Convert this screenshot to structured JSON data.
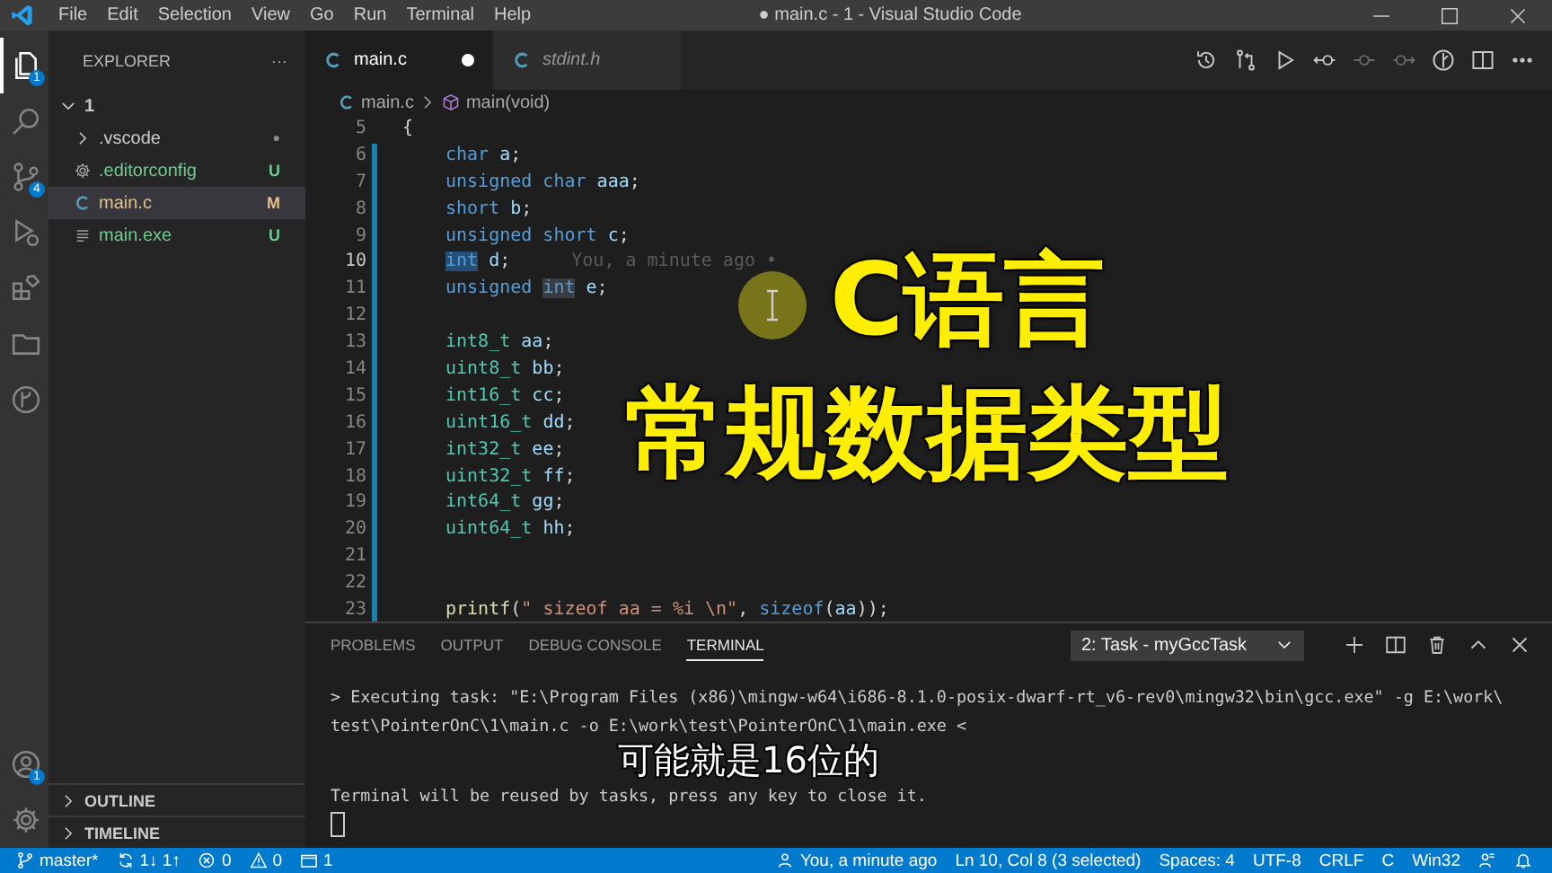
{
  "window": {
    "title": "● main.c - 1 - Visual Studio Code"
  },
  "menu": [
    "File",
    "Edit",
    "Selection",
    "View",
    "Go",
    "Run",
    "Terminal",
    "Help"
  ],
  "activity_bar": [
    {
      "kind": "explorer",
      "selected": true,
      "badge": "1"
    },
    {
      "kind": "search",
      "selected": false
    },
    {
      "kind": "source-control",
      "selected": false,
      "badge": "4"
    },
    {
      "kind": "run",
      "selected": false
    },
    {
      "kind": "extensions",
      "selected": false
    },
    {
      "kind": "folders",
      "selected": false
    },
    {
      "kind": "git-graph",
      "selected": false
    }
  ],
  "activity_bar_bottom": [
    {
      "kind": "account",
      "badge": "1"
    },
    {
      "kind": "settings"
    }
  ],
  "sidebar": {
    "title": "EXPLORER",
    "more": "···",
    "tree": [
      {
        "label": "1",
        "expanded": true,
        "children": [
          {
            "label": ".vscode",
            "kind": "folder",
            "expanded": false,
            "selected": false,
            "status": "●"
          },
          {
            "label": ".editorconfig",
            "kind": "config",
            "selected": false,
            "status": "U"
          },
          {
            "label": "main.c",
            "kind": "c",
            "selected": true,
            "status": "M"
          },
          {
            "label": "main.exe",
            "kind": "binary",
            "selected": false,
            "status": "U"
          }
        ]
      }
    ],
    "sections": [
      {
        "label": "OUTLINE",
        "expanded": false
      },
      {
        "label": "TIMELINE",
        "expanded": false
      }
    ]
  },
  "tabs": [
    {
      "label": "main.c",
      "selected": true,
      "dirty": true,
      "preview": false
    },
    {
      "label": "stdint.h",
      "selected": false,
      "dirty": false,
      "preview": true
    }
  ],
  "editor_actions": [
    {
      "kind": "history",
      "disabled": false
    },
    {
      "kind": "compare",
      "disabled": false
    },
    {
      "kind": "run",
      "disabled": false
    },
    {
      "kind": "commit-previous",
      "disabled": false
    },
    {
      "kind": "commit",
      "disabled": true
    },
    {
      "kind": "commit-next",
      "disabled": true
    },
    {
      "kind": "blame",
      "disabled": false
    },
    {
      "kind": "split",
      "disabled": false
    },
    {
      "kind": "more",
      "disabled": false
    }
  ],
  "breadcrumb": [
    {
      "label": "main.c",
      "kind": "file"
    },
    {
      "label": "main(void)",
      "kind": "function"
    }
  ],
  "code": [
    {
      "number": "5",
      "changed": false,
      "current": false,
      "indent": false,
      "tokens": [
        {
          "text": "{",
          "kind": "punct"
        }
      ]
    },
    {
      "number": "6",
      "changed": true,
      "current": false,
      "indent": true,
      "tokens": [
        {
          "text": "char",
          "kind": "keyword"
        },
        {
          "text": " a",
          "kind": "variable"
        },
        {
          "text": ";",
          "kind": "punct"
        }
      ]
    },
    {
      "number": "7",
      "changed": true,
      "current": false,
      "indent": true,
      "tokens": [
        {
          "text": "unsigned char",
          "kind": "keyword"
        },
        {
          "text": " aaa",
          "kind": "variable"
        },
        {
          "text": ";",
          "kind": "punct"
        }
      ]
    },
    {
      "number": "8",
      "changed": true,
      "current": false,
      "indent": true,
      "tokens": [
        {
          "text": "short",
          "kind": "keyword"
        },
        {
          "text": " b",
          "kind": "variable"
        },
        {
          "text": ";",
          "kind": "punct"
        }
      ]
    },
    {
      "number": "9",
      "changed": true,
      "current": false,
      "indent": true,
      "tokens": [
        {
          "text": "unsigned short",
          "kind": "keyword"
        },
        {
          "text": " c",
          "kind": "variable"
        },
        {
          "text": ";",
          "kind": "punct"
        }
      ]
    },
    {
      "number": "10",
      "changed": true,
      "current": true,
      "indent": true,
      "blame": "You, a minute ago •",
      "tokens": [
        {
          "text": "int",
          "kind": "keyword-selected"
        },
        {
          "text": " d",
          "kind": "variable"
        },
        {
          "text": ";",
          "kind": "punct"
        }
      ]
    },
    {
      "number": "11",
      "changed": true,
      "current": false,
      "indent": true,
      "tokens": [
        {
          "text": "unsigned ",
          "kind": "keyword"
        },
        {
          "text": "int",
          "kind": "keyword-match"
        },
        {
          "text": " e",
          "kind": "variable"
        },
        {
          "text": ";",
          "kind": "punct"
        }
      ]
    },
    {
      "number": "12",
      "changed": true,
      "current": false
    },
    {
      "number": "13",
      "changed": true,
      "current": false,
      "indent": true,
      "tokens": [
        {
          "text": "int8_t",
          "kind": "type"
        },
        {
          "text": " aa",
          "kind": "variable"
        },
        {
          "text": ";",
          "kind": "punct"
        }
      ]
    },
    {
      "number": "14",
      "changed": true,
      "current": false,
      "indent": true,
      "tokens": [
        {
          "text": "uint8_t",
          "kind": "type"
        },
        {
          "text": " bb",
          "kind": "variable"
        },
        {
          "text": ";",
          "kind": "punct"
        }
      ]
    },
    {
      "number": "15",
      "changed": true,
      "current": false,
      "indent": true,
      "tokens": [
        {
          "text": "int16_t",
          "kind": "type"
        },
        {
          "text": " cc",
          "kind": "variable"
        },
        {
          "text": ";",
          "kind": "punct"
        }
      ]
    },
    {
      "number": "16",
      "changed": true,
      "current": false,
      "indent": true,
      "tokens": [
        {
          "text": "uint16_t",
          "kind": "type"
        },
        {
          "text": " dd",
          "kind": "variable"
        },
        {
          "text": ";",
          "kind": "punct"
        }
      ]
    },
    {
      "number": "17",
      "changed": true,
      "current": false,
      "indent": true,
      "tokens": [
        {
          "text": "int32_t",
          "kind": "type"
        },
        {
          "text": " ee",
          "kind": "variable"
        },
        {
          "text": ";",
          "kind": "punct"
        }
      ]
    },
    {
      "number": "18",
      "changed": true,
      "current": false,
      "indent": true,
      "tokens": [
        {
          "text": "uint32_t",
          "kind": "type"
        },
        {
          "text": " ff",
          "kind": "variable"
        },
        {
          "text": ";",
          "kind": "punct"
        }
      ]
    },
    {
      "number": "19",
      "changed": true,
      "current": false,
      "indent": true,
      "tokens": [
        {
          "text": "int64_t",
          "kind": "type"
        },
        {
          "text": " gg",
          "kind": "variable"
        },
        {
          "text": ";",
          "kind": "punct"
        }
      ]
    },
    {
      "number": "20",
      "changed": true,
      "current": false,
      "indent": true,
      "tokens": [
        {
          "text": "uint64_t",
          "kind": "type"
        },
        {
          "text": " hh",
          "kind": "variable"
        },
        {
          "text": ";",
          "kind": "punct"
        }
      ]
    },
    {
      "number": "21",
      "changed": true,
      "current": false
    },
    {
      "number": "22",
      "changed": true,
      "current": false
    },
    {
      "number": "23",
      "changed": true,
      "current": false,
      "indent": true,
      "tokens": [
        {
          "text": "printf",
          "kind": "function"
        },
        {
          "text": "(",
          "kind": "punct"
        },
        {
          "text": "\" sizeof aa = %i \\n\"",
          "kind": "string"
        },
        {
          "text": ", ",
          "kind": "punct"
        },
        {
          "text": "sizeof",
          "kind": "keyword"
        },
        {
          "text": "(",
          "kind": "punct"
        },
        {
          "text": "aa",
          "kind": "variable"
        },
        {
          "text": "));",
          "kind": "punct"
        }
      ]
    }
  ],
  "panel": {
    "tabs": [
      {
        "label": "PROBLEMS",
        "selected": false
      },
      {
        "label": "OUTPUT",
        "selected": false
      },
      {
        "label": "DEBUG CONSOLE",
        "selected": false
      },
      {
        "label": "TERMINAL",
        "selected": true
      }
    ],
    "terminal_select": "2: Task - myGccTask",
    "actions": [
      {
        "kind": "plus"
      },
      {
        "kind": "split"
      },
      {
        "kind": "trash"
      },
      {
        "kind": "maximize"
      },
      {
        "kind": "close"
      }
    ],
    "terminal": [
      {
        "text": "> Executing task: \"E:\\Program Files (x86)\\mingw-w64\\i686-8.1.0-posix-dwarf-rt_v6-rev0\\mingw32\\bin\\gcc.exe\" -g E:\\work\\",
        "kind": "output"
      },
      {
        "text": "test\\PointerOnC\\1\\main.c -o E:\\work\\test\\PointerOnC\\1\\main.exe <",
        "kind": "output"
      },
      {
        "text": "Terminal will be reused by tasks, press any key to close it.",
        "kind": "message"
      },
      {
        "kind": "cursor"
      }
    ]
  },
  "status_bar": {
    "left": [
      {
        "kind": "branch",
        "text": "master*"
      },
      {
        "kind": "sync",
        "text": "1↓ 1↑"
      },
      {
        "kind": "errors",
        "text": "0"
      },
      {
        "kind": "warnings",
        "text": "0"
      },
      {
        "kind": "terminals",
        "text": "1"
      }
    ],
    "right": [
      {
        "kind": "blame",
        "text": "You, a minute ago"
      },
      {
        "kind": "position",
        "text": "Ln 10, Col 8 (3 selected)"
      },
      {
        "kind": "indent",
        "text": "Spaces: 4"
      },
      {
        "kind": "encoding",
        "text": "UTF-8"
      },
      {
        "kind": "eol",
        "text": "CRLF"
      },
      {
        "kind": "language",
        "text": "C"
      },
      {
        "kind": "config",
        "text": "Win32"
      },
      {
        "kind": "feedback"
      },
      {
        "kind": "notifications"
      }
    ]
  },
  "overlay": {
    "title": [
      "C语言",
      "常规数据类型"
    ],
    "subtitle": "可能就是16位的",
    "cursor_highlight": true
  }
}
